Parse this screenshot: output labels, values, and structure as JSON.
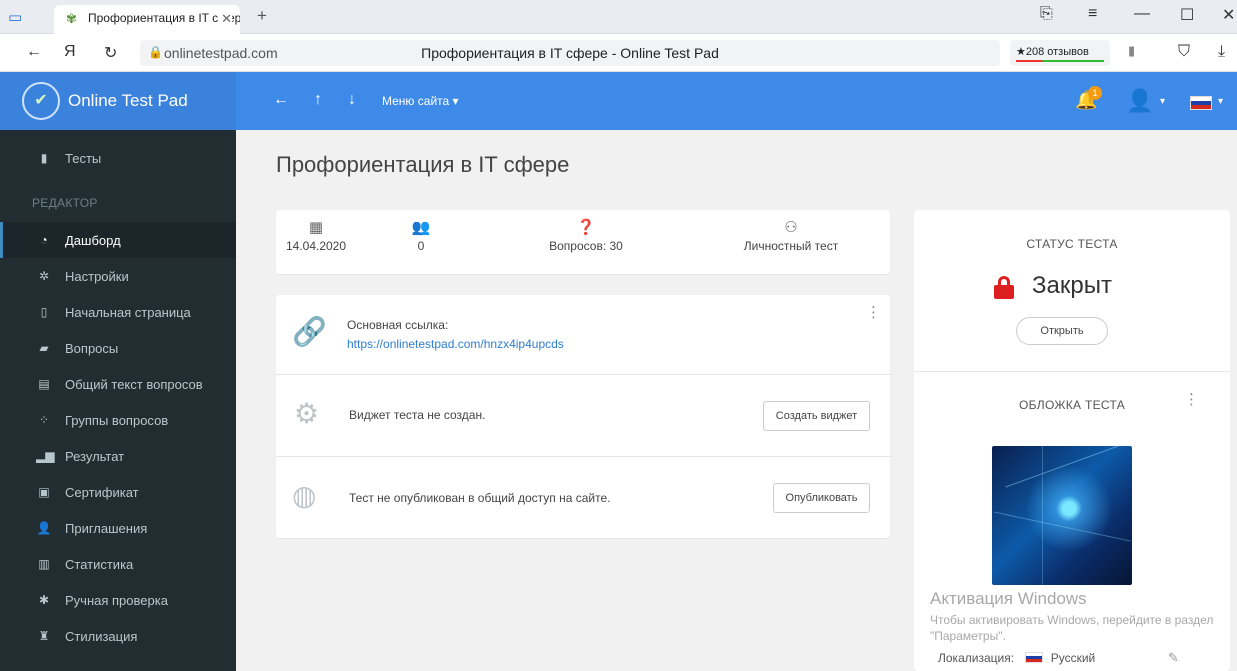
{
  "browser": {
    "tab_title": "Профориентация в IT сфере",
    "tab_close": "✕",
    "new_tab": "+",
    "url_host": "onlinetestpad.com",
    "page_title": "Профориентация в IT сфере - Online Test Pad",
    "reviews": "★208 отзывов",
    "nav_back": "←",
    "nav_yandex": "Я",
    "nav_reload": "↻"
  },
  "header": {
    "logo_text": "Online Test Pad",
    "nav_back": "←",
    "nav_up": "↑",
    "nav_down": "↓",
    "menu_label": "Меню сайта",
    "notifications_count": "1"
  },
  "sidebar": {
    "top_item": "Тесты",
    "section_header": "РЕДАКТОР",
    "items": [
      {
        "label": "Дашборд",
        "icon": "dashboard-icon",
        "active": true
      },
      {
        "label": "Настройки",
        "icon": "gear-icon"
      },
      {
        "label": "Начальная страница",
        "icon": "page-icon"
      },
      {
        "label": "Вопросы",
        "icon": "questions-icon"
      },
      {
        "label": "Общий текст вопросов",
        "icon": "text-icon"
      },
      {
        "label": "Группы вопросов",
        "icon": "groups-icon"
      },
      {
        "label": "Результат",
        "icon": "bar-chart-icon"
      },
      {
        "label": "Сертификат",
        "icon": "certificate-icon"
      },
      {
        "label": "Приглашения",
        "icon": "invite-icon"
      },
      {
        "label": "Статистика",
        "icon": "stats-icon"
      },
      {
        "label": "Ручная проверка",
        "icon": "review-icon"
      },
      {
        "label": "Стилизация",
        "icon": "style-icon"
      }
    ]
  },
  "main": {
    "title": "Профориентация в IT сфере",
    "stats": {
      "date": "14.04.2020",
      "participants": "0",
      "questions": "Вопросов: 30",
      "type": "Личностный тест"
    },
    "link": {
      "label": "Основная ссылка:",
      "url": "https://onlinetestpad.com/hnzx4ip4upcds"
    },
    "widget": {
      "text": "Виджет теста не создан.",
      "button": "Создать виджет"
    },
    "publish": {
      "text": "Тест не опубликован в общий доступ на сайте.",
      "button": "Опубликовать"
    }
  },
  "status_panel": {
    "title": "СТАТУС ТЕСТА",
    "value": "Закрыт",
    "button": "Открыть",
    "cover_title": "ОБЛОЖКА ТЕСТА",
    "localization_label": "Локализация:",
    "localization_value": "Русский"
  },
  "watermark": {
    "title": "Активация Windows",
    "text": "Чтобы активировать Windows, перейдите в раздел \"Параметры\"."
  }
}
